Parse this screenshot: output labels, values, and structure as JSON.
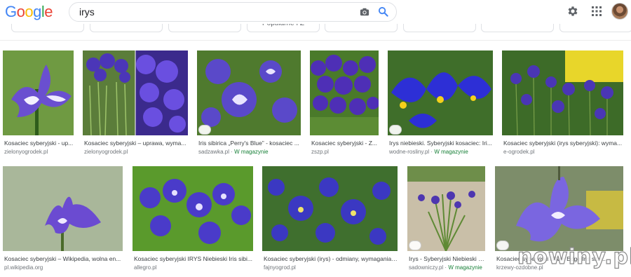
{
  "brand": {
    "logo_text": "Google",
    "colors": [
      "#4285F4",
      "#EA4335",
      "#FBBC05",
      "#4285F4",
      "#34A853",
      "#EA4335"
    ]
  },
  "search": {
    "query": "irys"
  },
  "header_icons": {
    "camera": "camera-icon",
    "search": "search-icon",
    "settings": "gear-icon",
    "apps": "apps-grid-icon",
    "account": "avatar"
  },
  "chips": [
    "",
    "",
    "",
    "Popularne I Z",
    "",
    "",
    "",
    ""
  ],
  "results": [
    {
      "caption": "Kosaciec syberyjski - up...",
      "source": "zielonyogrodek.pl",
      "shop": ""
    },
    {
      "caption": "Kosaciec syberyjski – uprawa, wyma...",
      "source": "zielonyogrodek.pl",
      "shop": ""
    },
    {
      "caption": "Iris sibirica „Perry's Blue” - kosaciec ...",
      "source": "sadzawka.pl · ",
      "shop": "W magazynie"
    },
    {
      "caption": "Kosaciec syberyjski - Z...",
      "source": "zszp.pl",
      "shop": ""
    },
    {
      "caption": "Irys niebieski. Syberyjski kosaciec: Iri...",
      "source": "wodne-rosliny.pl · ",
      "shop": "W magazynie"
    },
    {
      "caption": "Kosaciec syberyjski (irys syberyjski): wyma...",
      "source": "e-ogrodek.pl",
      "shop": ""
    },
    {
      "caption": "Kosaciec syberyjski – Wikipedia, wolna en...",
      "source": "pl.wikipedia.org",
      "shop": ""
    },
    {
      "caption": "Kosaciec syberyjski IRYS Niebieski Iris sibi...",
      "source": "allegro.pl",
      "shop": ""
    },
    {
      "caption": "Kosaciec syberyjski (irys) - odmiany, wymagania,...",
      "source": "fajnyogrod.pl",
      "shop": ""
    },
    {
      "caption": "Irys - Syberyjski Niebieski -...",
      "source": "sadowniczy.pl · ",
      "shop": "W magazynie"
    },
    {
      "caption": "Kosaciec syberyjski Silver Edge Iris sibir...",
      "source": "krzewy-ozdobne.pl",
      "shop": ""
    }
  ],
  "watermark": "nowiny.pl"
}
